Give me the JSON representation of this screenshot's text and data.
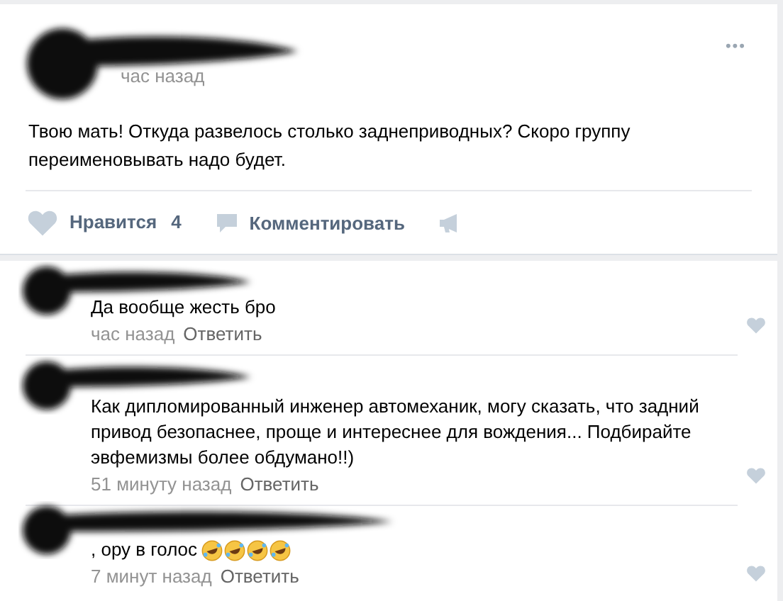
{
  "post": {
    "author_redacted": true,
    "time": "час назад",
    "text": "Твою мать! Откуда развелось столько заднеприводных? Скоро группу переименовывать надо будет.",
    "menu": "•••",
    "like": {
      "label": "Нравится",
      "count": "4",
      "liked": false
    },
    "comment_label": "Комментировать"
  },
  "comments": [
    {
      "author_redacted": true,
      "text": "Да вообще жесть бро",
      "time": "час назад",
      "reply": "Ответить",
      "liked": false
    },
    {
      "author_redacted": true,
      "text": "Как дипломированный инженер автомеханик, могу сказать, что задний привод безопаснее, проще и интереснее для вождения... Подбирайте эвфемизмы более обдумано!!)",
      "time": "51 минуту назад",
      "reply": "Ответить",
      "liked": false
    },
    {
      "author_redacted": true,
      "text": ", ору в голос",
      "emoji": [
        {
          "kind": "rofl"
        },
        {
          "kind": "rofl"
        },
        {
          "kind": "rofl"
        },
        {
          "kind": "rofl"
        }
      ],
      "time": "7 минут назад",
      "reply": "Ответить",
      "liked": false
    }
  ]
}
